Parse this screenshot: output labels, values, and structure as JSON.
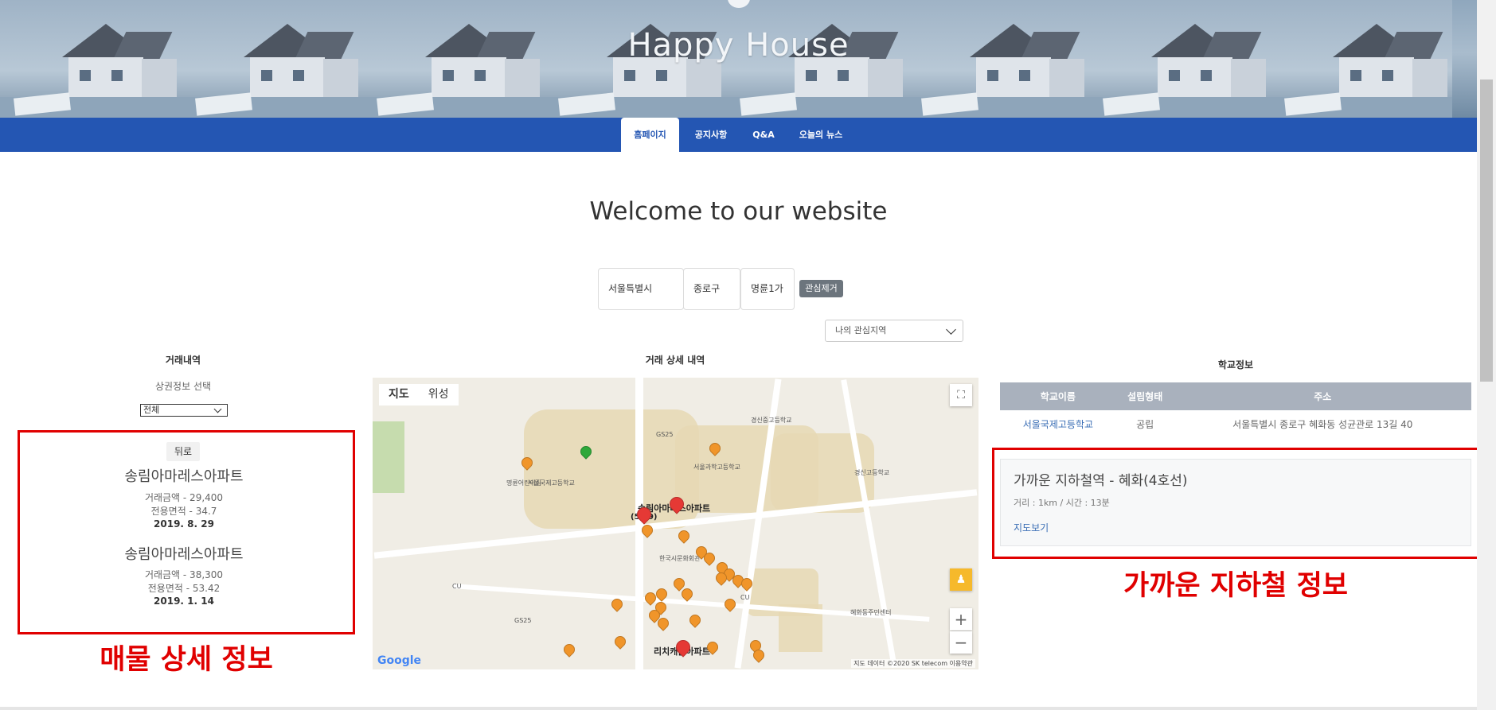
{
  "header": {
    "site_title": "Happy House"
  },
  "nav": {
    "tabs": [
      {
        "label": "홈페이지",
        "active": true
      },
      {
        "label": "공지사항",
        "active": false
      },
      {
        "label": "Q&A",
        "active": false
      },
      {
        "label": "오늘의 뉴스",
        "active": false
      }
    ]
  },
  "main": {
    "welcome": "Welcome to our website"
  },
  "region": {
    "city": "서울특별시",
    "district": "종로구",
    "dong": "명륜1가",
    "remove_button": "관심제거",
    "favorite_select": "나의 관심지역"
  },
  "deals": {
    "heading": "거래내역",
    "filter_label": "상권정보 선택",
    "filter_value": "전체",
    "back_button": "뒤로",
    "items": [
      {
        "name": "송림아마레스아파트",
        "price": "거래금액 - 29,400",
        "area": "전용면적 - 34.7",
        "date": "2019. 8. 29"
      },
      {
        "name": "송림아마레스아파트",
        "price": "거래금액 - 38,300",
        "area": "전용면적 - 53.42",
        "date": "2019. 1. 14"
      }
    ],
    "annotation": "매물 상세 정보"
  },
  "map": {
    "heading": "거래 상세 내역",
    "type_map": "지도",
    "type_satellite": "위성",
    "zoom_in": "+",
    "zoom_out": "−",
    "google": "Google",
    "footer": "지도 데이터 ©2020 SK telecom   이용약관",
    "labels": {
      "apt_main": "송림아마레스아파트",
      "apt_count": "(5 69)",
      "apt_bottom": "리치캐슬아파트",
      "school1": "서울국제고등학교",
      "school2": "서울과학고등학교",
      "school3": "경신고등학교",
      "school4": "경신중고등학교",
      "cafe": "혜화동주민센터",
      "gs25": "GS25",
      "cu": "CU",
      "church": "명륜어린이집",
      "cafe2": "한국시문화회관"
    }
  },
  "school": {
    "heading": "학교정보",
    "columns": [
      "학교이름",
      "설립형태",
      "주소"
    ],
    "rows": [
      {
        "name": "서울국제고등학교",
        "type": "공립",
        "address": "서울특별시 종로구 혜화동 성균관로 13길 40"
      }
    ]
  },
  "subway": {
    "title": "가까운 지하철역 - 혜화(4호선)",
    "meta": "거리 : 1km / 시간 : 13분",
    "link": "지도보기",
    "annotation": "가까운 지하철 정보"
  },
  "colors": {
    "nav": "#2456b3",
    "annotation": "#e00000"
  }
}
